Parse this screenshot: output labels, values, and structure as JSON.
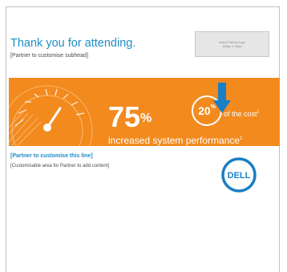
{
  "header": {
    "title": "Thank you for attending.",
    "subhead": "[Partner to customise subhead]",
    "logo_placeholder_line1": "Insert Partner logo",
    "logo_placeholder_line2": "180px X 45px"
  },
  "banner": {
    "big_number": "75",
    "big_unit": "%",
    "badge_number": "20",
    "badge_unit": "%",
    "cost_text": "of the cost",
    "cost_superscript": "1",
    "performance_text": "increased system performance",
    "performance_superscript": "1",
    "icons": [
      "speedometer-icon",
      "down-arrow-icon"
    ]
  },
  "footer": {
    "partner_line": "[Partner to customise this line]",
    "custom_area": "[Customisable area for Partner to add content]",
    "brand": "DELL"
  },
  "colors": {
    "accent_blue": "#1e8ec6",
    "banner_orange": "#f28a1e",
    "arrow_blue": "#1a7fc4"
  }
}
